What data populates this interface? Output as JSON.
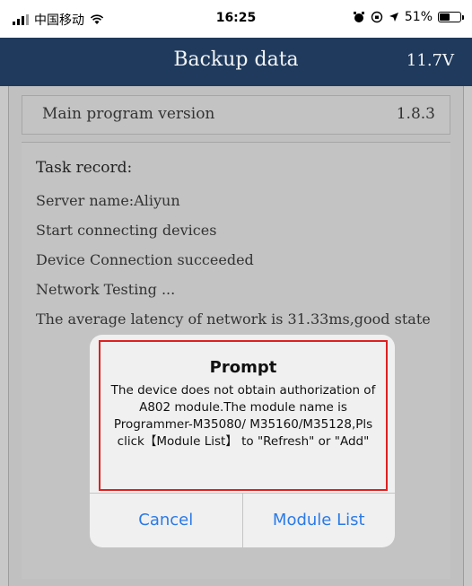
{
  "status_bar": {
    "carrier": "中国移动",
    "time": "16:25",
    "battery": "51%",
    "battery_level": 0.51
  },
  "nav": {
    "title": "Backup data",
    "voltage": "11.7V"
  },
  "version": {
    "label": "Main program version",
    "value": "1.8.3"
  },
  "task_record": {
    "title": "Task record:",
    "lines": [
      "Server name:Aliyun",
      "Start connecting devices",
      "Device Connection succeeded",
      "Network Testing ...",
      "The average latency of network is 31.33ms,good state"
    ]
  },
  "dialog": {
    "title": "Prompt",
    "message": "The device does not obtain authorization of A802 module.The module name is Programmer-M35080/ M35160/M35128,Pls click【Module List】 to \"Refresh\" or \"Add\"",
    "cancel_label": "Cancel",
    "confirm_label": "Module List"
  },
  "colors": {
    "nav_background": "#1f3a5c",
    "dialog_button_text": "#2a7ae8",
    "highlight_border": "#e02020"
  }
}
